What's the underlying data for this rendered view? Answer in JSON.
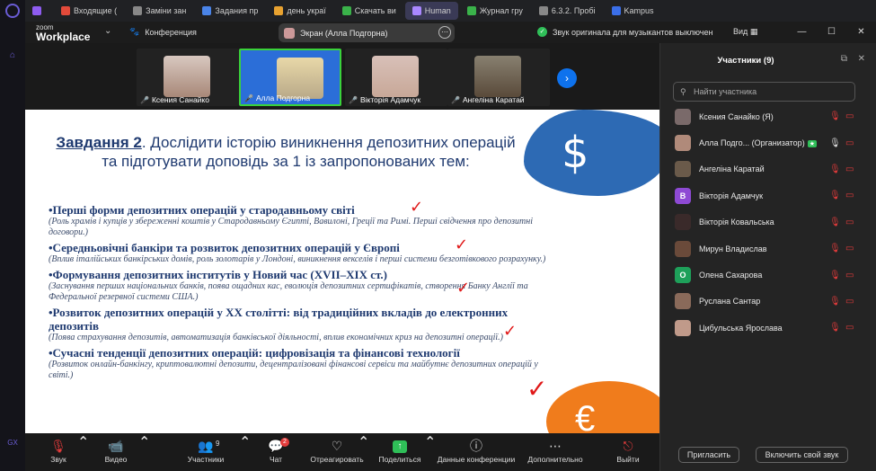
{
  "browser": {
    "tabs": [
      {
        "label": "",
        "color": "#8e5cf0"
      },
      {
        "label": "Входящие (",
        "color": "#e24a3a"
      },
      {
        "label": "Заміни зан",
        "color": "#888888"
      },
      {
        "label": "Задания пр",
        "color": "#4a84e8"
      },
      {
        "label": "день украї",
        "color": "#e8a230"
      },
      {
        "label": "Скачать ви",
        "color": "#3ab24a"
      },
      {
        "label": "Human",
        "color": "#aa88ff"
      },
      {
        "label": "Журнал гру",
        "color": "#3ab24a"
      },
      {
        "label": "6.3.2. Пробі",
        "color": "#888888"
      },
      {
        "label": "Kampus",
        "color": "#3a6ee8"
      }
    ],
    "side_icons": [
      "gx-icon"
    ]
  },
  "zoom_header": {
    "logo_top": "zoom",
    "logo_bottom": "Workplace",
    "conference_label": "Конференция",
    "screen_label": "Экран (Алла Подгорна)",
    "sound_note": "Звук оригинала для музыкантов выключен",
    "view_label": "Вид"
  },
  "filmstrip": [
    {
      "name": "Ксения Санайко",
      "muted": true
    },
    {
      "name": "Алла Подгорна",
      "muted": true,
      "speaker": true
    },
    {
      "name": "Вікторія Адамчук",
      "muted": true
    },
    {
      "name": "Ангеліна Каратай",
      "muted": true
    }
  ],
  "slide": {
    "title_lead": "Завдання 2",
    "title_rest": ". Дослідити історію виникнення депозитних операцій та підготувати доповідь за 1 із запропонованих тем:",
    "items": [
      {
        "head": "•Перші форми депозитних операцій у стародавньому світі",
        "desc": "(Роль храмів і купців у збереженні коштів у Стародавньому Єгипті, Вавилоні, Греції та Римі. Перші свідчення про депозитні договори.)"
      },
      {
        "head": "•Середньовічні банкіри та розвиток депозитних операцій у Європі",
        "desc": "(Вплив італійських банкірських домів, роль золотарів у Лондоні, виникнення векселів і перші системи безготівкового розрахунку.)"
      },
      {
        "head": "•Формування депозитних інститутів у Новий час (XVII–XIX ст.)",
        "desc": "(Заснування перших національних банків, поява ощадних кас, еволюція депозитних сертифікатів, створення Банку Англії та Федеральної резервної системи США.)"
      },
      {
        "head": "•Розвиток депозитних операцій у XX столітті: від традиційних вкладів до електронних депозитів",
        "desc": "(Поява страхування депозитів, автоматизація банківської діяльності, вплив економічних криз на депозитні операції.)"
      },
      {
        "head": "•Сучасні тенденції депозитних операцій: цифровізація та фінансові технології",
        "desc": "(Розвиток онлайн-банкінгу, криптовалютні депозити, децентралізовані фінансові сервіси та майбутнє депозитних операцій у світі.)"
      }
    ],
    "dollar_symbol": "$",
    "euro_symbol": "€"
  },
  "toolbar": {
    "audio": "Звук",
    "video": "Видео",
    "participants": "Участники",
    "participants_count": "9",
    "chat": "Чат",
    "chat_badge": "2",
    "react": "Отреагировать",
    "share": "Поделиться",
    "meeting_info": "Данные конференции",
    "more": "Дополнительно",
    "leave": "Выйти"
  },
  "panel": {
    "title": "Участники (9)",
    "search_placeholder": "Найти участника",
    "participants": [
      {
        "name": "Ксения Санайко (Я)",
        "initial": "",
        "color": "#7a6a6a",
        "mic_on": false,
        "host": false
      },
      {
        "name": "Алла Подго... (Организатор)",
        "initial": "",
        "color": "#b08a7a",
        "mic_on": true,
        "host": true
      },
      {
        "name": "Ангеліна Каратай",
        "initial": "",
        "color": "#6a5a4a",
        "mic_on": false,
        "host": false
      },
      {
        "name": "Вікторія Адамчук",
        "initial": "В",
        "color": "#8e4ad4",
        "mic_on": false,
        "host": false
      },
      {
        "name": "Вікторія Ковальська",
        "initial": "",
        "color": "#3a2a2a",
        "mic_on": false,
        "host": false
      },
      {
        "name": "Мирун Владислав",
        "initial": "",
        "color": "#6a4a3a",
        "mic_on": false,
        "host": false
      },
      {
        "name": "Олена Сахарова",
        "initial": "О",
        "color": "#1ea05a",
        "mic_on": false,
        "host": false
      },
      {
        "name": "Руслана Сантар",
        "initial": "",
        "color": "#8a6a5a",
        "mic_on": false,
        "host": false
      },
      {
        "name": "Цибульська Ярослава",
        "initial": "",
        "color": "#c09a8a",
        "mic_on": false,
        "host": false
      }
    ],
    "invite_label": "Пригласить",
    "unmute_label": "Включить свой звук",
    "host_tag": "★"
  }
}
